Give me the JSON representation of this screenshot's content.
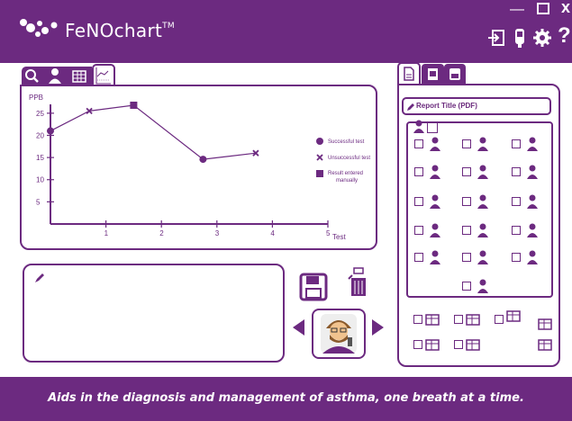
{
  "app": {
    "title": "FeNOchart",
    "trademark": "TM",
    "window_controls": {
      "minimize": "—",
      "maximize": "☐",
      "close": "x"
    }
  },
  "header_icons": [
    "exit-icon",
    "device-icon",
    "settings-gear-icon",
    "help-icon"
  ],
  "colors": {
    "brand": "#6c2a80",
    "background": "#ffffff",
    "text_light": "#ffffff"
  },
  "chart_tabs": [
    "search-icon",
    "person-icon",
    "table-icon",
    "chart-icon"
  ],
  "chart_data": {
    "type": "line",
    "ylabel": "PPB",
    "xlabel": "Test",
    "xlim": [
      0,
      5
    ],
    "ylim": [
      0,
      27
    ],
    "x_ticks": [
      "1",
      "2",
      "3",
      "4",
      "5"
    ],
    "y_ticks": [
      "5",
      "10",
      "15",
      "20",
      "25"
    ],
    "grid": false,
    "legend_placement": "right",
    "series": [
      {
        "points": [
          {
            "x": 0,
            "y": 21,
            "marker": "successful"
          },
          {
            "x": 0.7,
            "y": 25.5,
            "marker": "unsuccessful"
          },
          {
            "x": 1.5,
            "y": 26.8,
            "marker": "manual"
          },
          {
            "x": 2.75,
            "y": 14.6,
            "marker": "successful"
          },
          {
            "x": 3.7,
            "y": 16,
            "marker": "unsuccessful"
          }
        ]
      }
    ],
    "legend": [
      {
        "marker": "successful",
        "label": "Successful test"
      },
      {
        "marker": "unsuccessful",
        "label": "Unsuccessful test"
      },
      {
        "marker": "manual",
        "label": "Result entered manually"
      }
    ]
  },
  "notes": {
    "icon": "pencil-icon",
    "text": ""
  },
  "actions": {
    "save_icon": "save-disk-icon",
    "trash_icon": "trash-bin-icon",
    "avatar": "doctor-avatar",
    "prev": "previous-arrow",
    "next": "next-arrow"
  },
  "right_panel": {
    "tabs": [
      "pdf-page-icon",
      "export-icon",
      "print-icon"
    ],
    "report_title": "Report Title (PDF)",
    "grid_items": [
      "edit-person-icon",
      "calendar-icon",
      "id-card-icon",
      "patient-info-icon",
      "camera-icon",
      "gender-icon",
      "person-sitting-icon",
      "family-icon",
      "person-pain-icon",
      "medication-icon",
      "smoking-icon",
      "clipboard-icon",
      "location-icon",
      "phone-icon",
      "person-standing-icon",
      "doctor-icon"
    ],
    "bottom_items": [
      "chart-mini-icon",
      "dots-logo-icon",
      "images-icon",
      "email-icon",
      "table-mini-icon",
      "pencil-mini-icon",
      "magnify-doc-icon"
    ]
  },
  "footer": {
    "tagline": "Aids in the diagnosis and management of asthma, one breath at a time."
  }
}
